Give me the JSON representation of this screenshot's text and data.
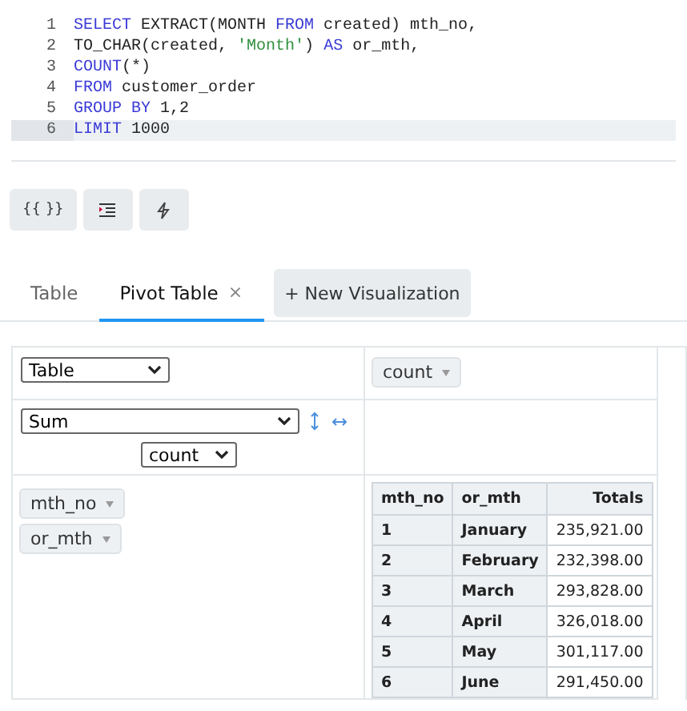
{
  "editor": {
    "lines": [
      {
        "number": "1",
        "active": false,
        "tokens": [
          {
            "kind": "keyword",
            "text": "SELECT"
          },
          {
            "kind": "plain",
            "text": " EXTRACT(MONTH "
          },
          {
            "kind": "keyword",
            "text": "FROM"
          },
          {
            "kind": "plain",
            "text": " created) mth_no,"
          }
        ]
      },
      {
        "number": "2",
        "active": false,
        "tokens": [
          {
            "kind": "plain",
            "text": "TO_CHAR(created, "
          },
          {
            "kind": "string",
            "text": "'Month'"
          },
          {
            "kind": "plain",
            "text": ") "
          },
          {
            "kind": "keyword",
            "text": "AS"
          },
          {
            "kind": "plain",
            "text": " or_mth,"
          }
        ]
      },
      {
        "number": "3",
        "active": false,
        "tokens": [
          {
            "kind": "keyword",
            "text": "COUNT"
          },
          {
            "kind": "plain",
            "text": "(*)"
          }
        ]
      },
      {
        "number": "4",
        "active": false,
        "tokens": [
          {
            "kind": "keyword",
            "text": "FROM"
          },
          {
            "kind": "plain",
            "text": " customer_order"
          }
        ]
      },
      {
        "number": "5",
        "active": false,
        "tokens": [
          {
            "kind": "keyword",
            "text": "GROUP BY"
          },
          {
            "kind": "plain",
            "text": " 1,2"
          }
        ]
      },
      {
        "number": "6",
        "active": true,
        "tokens": [
          {
            "kind": "keyword",
            "text": "LIMIT"
          },
          {
            "kind": "plain",
            "text": " 1000"
          }
        ]
      }
    ]
  },
  "toolbar": [
    {
      "kind": "braces",
      "label": "{{ }}"
    },
    {
      "kind": "indent"
    },
    {
      "kind": "bolt"
    }
  ],
  "tabs": [
    {
      "label": "Table",
      "selected": false
    },
    {
      "label": "Pivot Table",
      "selected": true,
      "close": "×"
    }
  ],
  "new_visualization": "+ New Visualization",
  "pivot": {
    "renderer": "Table",
    "aggregator": "Sum",
    "aggregator_field": "count",
    "unused_fields": [
      "count"
    ],
    "row_fields": [
      "mth_no",
      "or_mth"
    ],
    "table": {
      "columns": [
        "mth_no",
        "or_mth",
        "Totals"
      ],
      "rows": [
        [
          "1",
          "January",
          "235,921.00"
        ],
        [
          "2",
          "February",
          "232,398.00"
        ],
        [
          "3",
          "March",
          "293,828.00"
        ],
        [
          "4",
          "April",
          "326,018.00"
        ],
        [
          "5",
          "May",
          "301,117.00"
        ],
        [
          "6",
          "June",
          "291,450.00"
        ]
      ]
    }
  }
}
